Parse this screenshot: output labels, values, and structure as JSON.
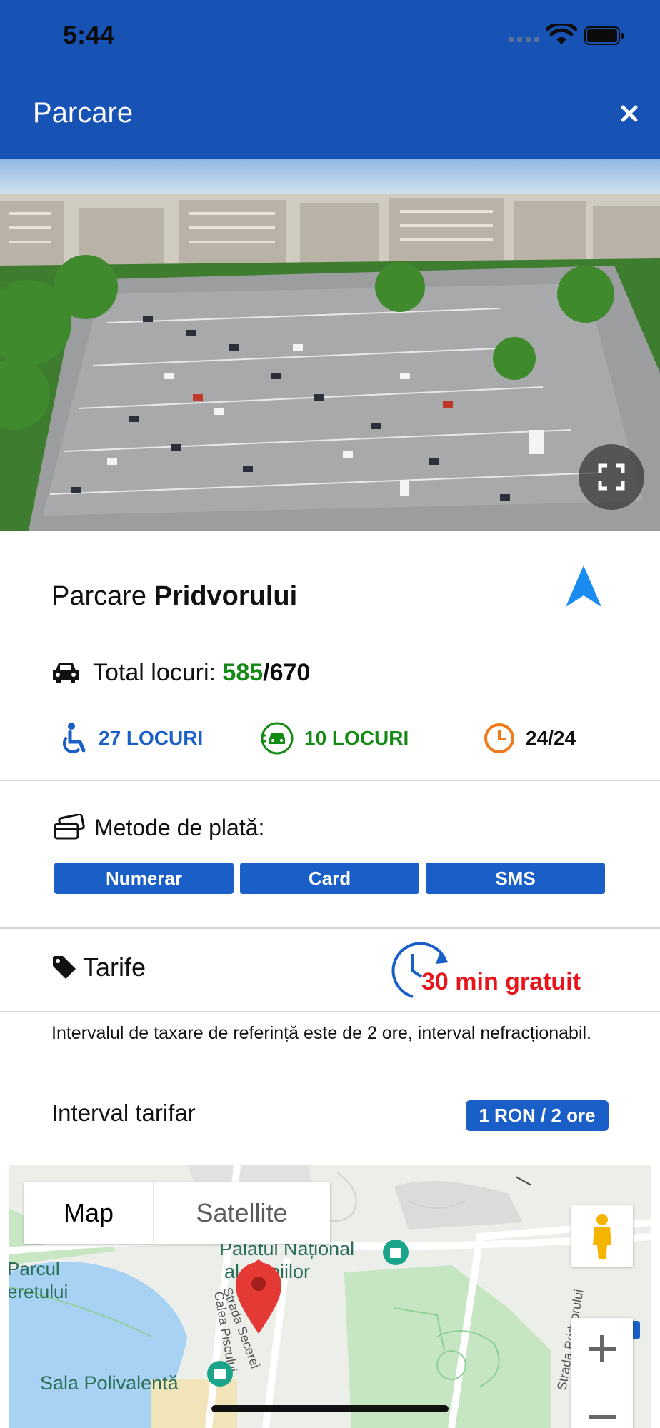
{
  "status_bar": {
    "time": "5:44"
  },
  "header": {
    "title": "Parcare",
    "close_icon": "close-icon"
  },
  "hero": {
    "image": "aerial-parking-lot-photo",
    "expand_icon": "fullscreen-icon"
  },
  "parking": {
    "name_prefix": "Parcare",
    "name_bold": "Pridvorului",
    "total_label": "Total locuri:",
    "free": "585",
    "separator": "/",
    "total": "670"
  },
  "features": {
    "disabled": "27 LOCURI",
    "electric": "10 LOCURI",
    "hours": "24/24"
  },
  "payment": {
    "label": "Metode de plată:",
    "methods": [
      "Numerar",
      "Card",
      "SMS"
    ]
  },
  "tarife": {
    "label": "Tarife",
    "free_time": "30 min gratuit",
    "description": "Intervalul de taxare de referință este de 2 ore, interval nefracționabil.",
    "interval_label": "Interval tarifar",
    "price": "1 RON / 2 ore"
  },
  "map": {
    "tab_map": "Map",
    "tab_satellite": "Satellite",
    "labels": {
      "palat_line1": "Palatul Național",
      "palat_line2": "al Copiilor",
      "parcul_line1": "Parcul",
      "parcul_line2": "eretului",
      "sala": "Sala Polivalentă",
      "calea": "Calea Piscului",
      "secerei": "Strada Secerei",
      "pridvorului": "Strada Pridvorului"
    }
  },
  "colors": {
    "header": "#1753b5",
    "accent_blue": "#1a5fc7",
    "green": "#148a14",
    "red": "#e8141b",
    "orange": "#f07a1a"
  }
}
